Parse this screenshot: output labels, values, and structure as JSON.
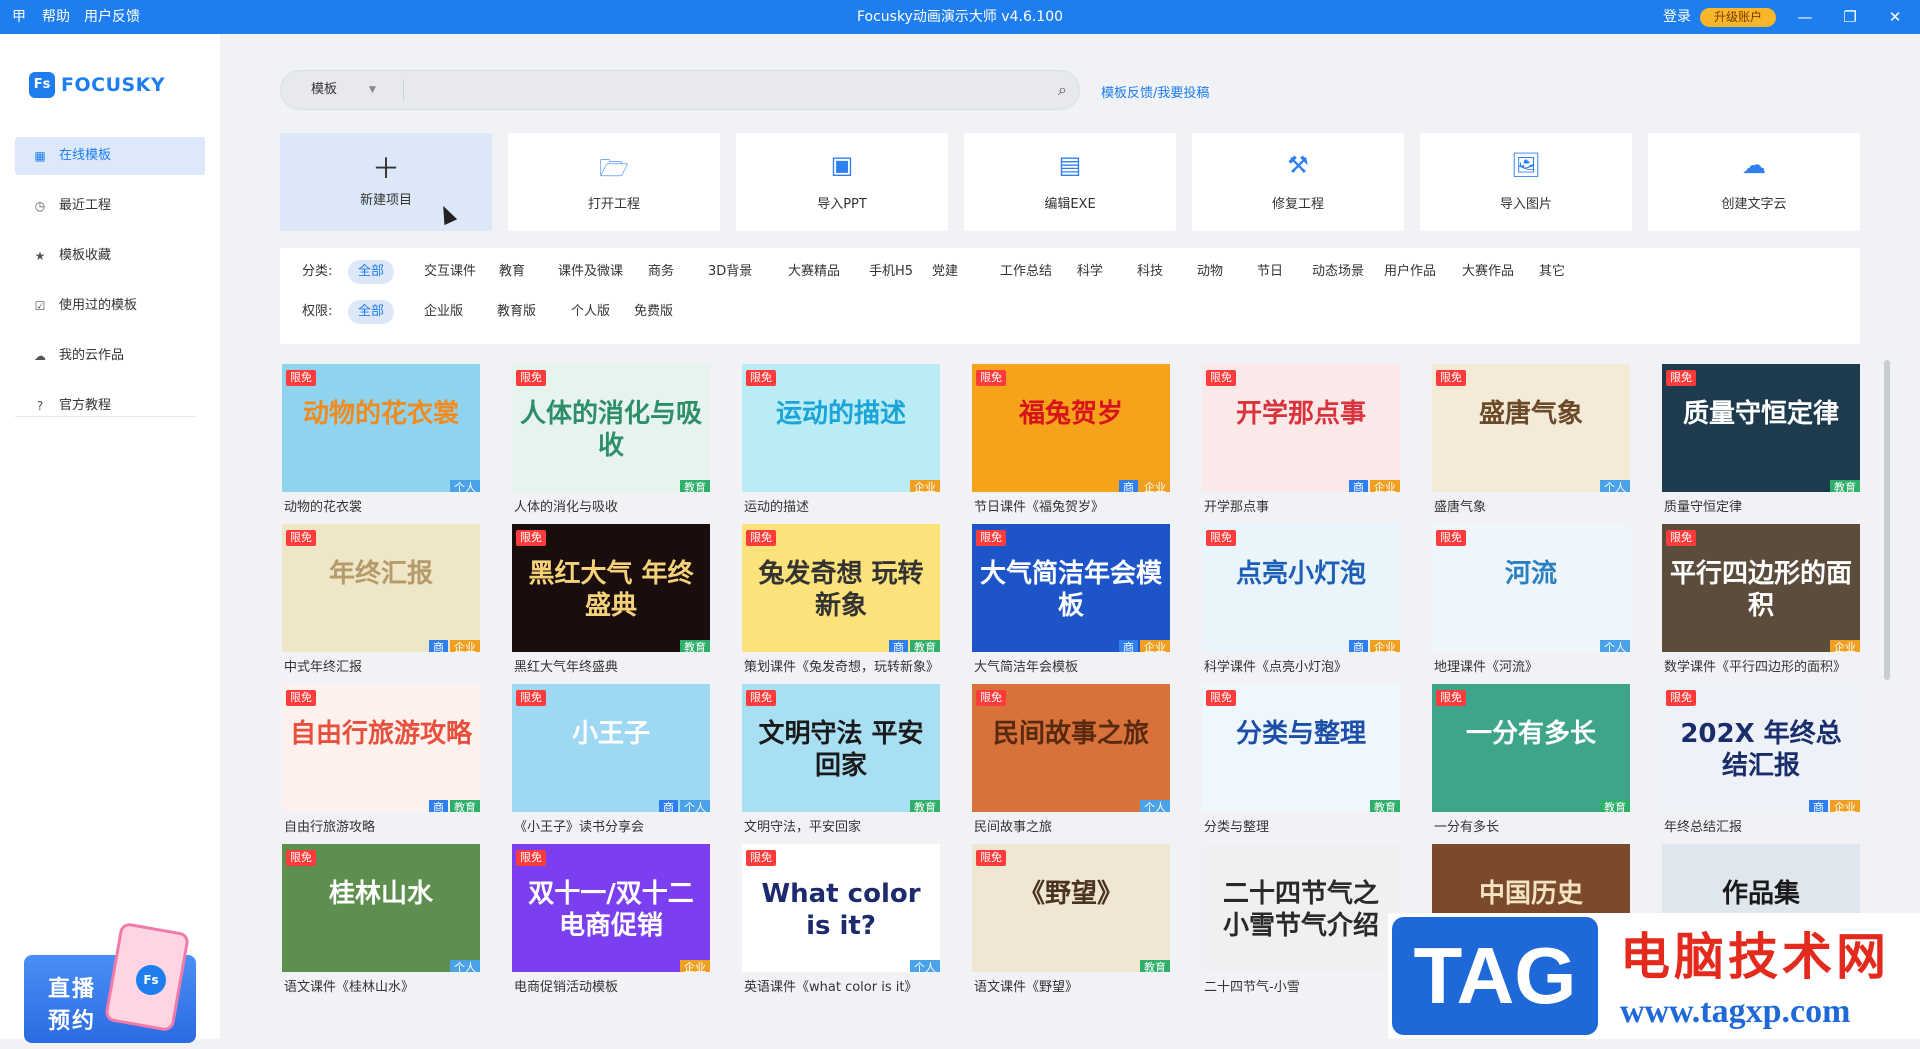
{
  "titlebar": {
    "pin": "甲",
    "help": "帮助",
    "feedback": "用户反馈",
    "title": "Focusky动画演示大师 v4.6.100",
    "login": "登录",
    "upgrade": "升级账户",
    "min": "—",
    "max": "❐",
    "close": "✕"
  },
  "logo": {
    "mark": "Fs",
    "name": "FOCUSKY"
  },
  "nav": [
    {
      "label": "在线模板",
      "icon": "grid-icon"
    },
    {
      "label": "最近工程",
      "icon": "clock-icon"
    },
    {
      "label": "模板收藏",
      "icon": "star-icon"
    },
    {
      "label": "使用过的模板",
      "icon": "check-icon"
    },
    {
      "label": "我的云作品",
      "icon": "cloud-icon"
    },
    {
      "label": "官方教程",
      "icon": "help-icon"
    }
  ],
  "promo": {
    "line1": "直播",
    "line2": "预约",
    "badge": "Fs"
  },
  "search": {
    "category": "模板",
    "value": ""
  },
  "feedback_link": "模板反馈/我要投稿",
  "actions": [
    {
      "label": "新建项目",
      "glyph": "＋"
    },
    {
      "label": "打开工程",
      "glyph": "🗁"
    },
    {
      "label": "导入PPT",
      "glyph": "▣"
    },
    {
      "label": "编辑EXE",
      "glyph": "▤"
    },
    {
      "label": "修复工程",
      "glyph": "⚒"
    },
    {
      "label": "导入图片",
      "glyph": "🖼"
    },
    {
      "label": "创建文字云",
      "glyph": "☁"
    }
  ],
  "filters": {
    "cat_label": "分类:",
    "categories": [
      "全部",
      "交互课件",
      "教育",
      "课件及微课",
      "商务",
      "3D背景",
      "大赛精品",
      "手机H5",
      "党建",
      "工作总结",
      "科学",
      "科技",
      "动物",
      "节日",
      "动态场景",
      "用户作品",
      "大赛作品",
      "其它"
    ],
    "perm_label": "权限:",
    "permissions": [
      "全部",
      "企业版",
      "教育版",
      "个人版",
      "免费版"
    ]
  },
  "templates": [
    {
      "name": "动物的花衣裳",
      "thumb": "动物的花衣裳",
      "xm": "限免",
      "tags": [
        "个人"
      ],
      "bg": "#8fd3ef",
      "fg": "#f28a1c"
    },
    {
      "name": "人体的消化与吸收",
      "thumb": "人体的消化与吸收",
      "xm": "限免",
      "tags": [
        "教育"
      ],
      "bg": "#e7f3ee",
      "fg": "#2d8f6a"
    },
    {
      "name": "运动的描述",
      "thumb": "运动的描述",
      "xm": "限免",
      "tags": [
        "企业"
      ],
      "bg": "#b9ecf5",
      "fg": "#1aa4d8"
    },
    {
      "name": "节日课件《福兔贺岁》",
      "thumb": "福兔贺岁",
      "xm": "限免",
      "tags": [
        "商",
        "企业"
      ],
      "bg": "#f7a21b",
      "fg": "#d6141b"
    },
    {
      "name": "开学那点事",
      "thumb": "开学那点事",
      "xm": "限免",
      "tags": [
        "商",
        "企业"
      ],
      "bg": "#fbe9ea",
      "fg": "#d9343e"
    },
    {
      "name": "盛唐气象",
      "thumb": "盛唐气象",
      "xm": "限免",
      "tags": [
        "个人"
      ],
      "bg": "#f3ead7",
      "fg": "#6b4a2a"
    },
    {
      "name": "质量守恒定律",
      "thumb": "质量守恒定律",
      "xm": "限免",
      "tags": [
        "教育"
      ],
      "bg": "#1d3b4d",
      "fg": "#ffffff"
    },
    {
      "name": "中式年终汇报",
      "thumb": "年终汇报",
      "xm": "限免",
      "tags": [
        "商",
        "企业"
      ],
      "bg": "#efe6c8",
      "fg": "#b59a6a"
    },
    {
      "name": "黑红大气年终盛典",
      "thumb": "黑红大气 年终盛典",
      "xm": "限免",
      "tags": [
        "教育"
      ],
      "bg": "#1a0d0d",
      "fg": "#f5d27a"
    },
    {
      "name": "策划课件《兔发奇想，玩转新象》",
      "thumb": "兔发奇想 玩转新象",
      "xm": "限免",
      "tags": [
        "商",
        "教育"
      ],
      "bg": "#fbe27a",
      "fg": "#333333"
    },
    {
      "name": "大气简洁年会模板",
      "thumb": "大气简洁年会模板",
      "xm": "限免",
      "tags": [
        "商",
        "企业"
      ],
      "bg": "#1d55c8",
      "fg": "#ffffff"
    },
    {
      "name": "科学课件《点亮小灯泡》",
      "thumb": "点亮小灯泡",
      "xm": "限免",
      "tags": [
        "商",
        "企业"
      ],
      "bg": "#e9f4fb",
      "fg": "#1d5fb6"
    },
    {
      "name": "地理课件《河流》",
      "thumb": "河流",
      "xm": "限免",
      "tags": [
        "个人"
      ],
      "bg": "#eef6fb",
      "fg": "#2a7fc0"
    },
    {
      "name": "数学课件《平行四边形的面积》",
      "thumb": "平行四边形的面积",
      "xm": "限免",
      "tags": [
        "企业"
      ],
      "bg": "#5c4c3c",
      "fg": "#ffffff"
    },
    {
      "name": "自由行旅游攻略",
      "thumb": "自由行旅游攻略",
      "xm": "限免",
      "tags": [
        "商",
        "教育"
      ],
      "bg": "#fdf1ee",
      "fg": "#e8503e"
    },
    {
      "name": "《小王子》读书分享会",
      "thumb": "小王子",
      "xm": "限免",
      "tags": [
        "商",
        "个人"
      ],
      "bg": "#9fd8f2",
      "fg": "#ffffff"
    },
    {
      "name": "文明守法，平安回家",
      "thumb": "文明守法 平安回家",
      "xm": "限免",
      "tags": [
        "教育"
      ],
      "bg": "#a8dff3",
      "fg": "#1a1a1a"
    },
    {
      "name": "民间故事之旅",
      "thumb": "民间故事之旅",
      "xm": "限免",
      "tags": [
        "个人"
      ],
      "bg": "#d9723a",
      "fg": "#5a2a10"
    },
    {
      "name": "分类与整理",
      "thumb": "分类与整理",
      "xm": "限免",
      "tags": [
        "教育"
      ],
      "bg": "#eef7fc",
      "fg": "#1e4fa8"
    },
    {
      "name": "一分有多长",
      "thumb": "一分有多长",
      "xm": "限免",
      "tags": [
        "教育"
      ],
      "bg": "#3fa58a",
      "fg": "#ffffff"
    },
    {
      "name": "年终总结汇报",
      "thumb": "202X 年终总结汇报",
      "xm": "限免",
      "tags": [
        "商",
        "企业"
      ],
      "bg": "#eef1f8",
      "fg": "#1a2d6b"
    },
    {
      "name": "语文课件《桂林山水》",
      "thumb": "桂林山水",
      "xm": "限免",
      "tags": [
        "个人"
      ],
      "bg": "#5f8f4e",
      "fg": "#ffffff"
    },
    {
      "name": "电商促销活动模板",
      "thumb": "双十一/双十二 电商促销",
      "xm": "限免",
      "tags": [
        "企业"
      ],
      "bg": "#7b3ff0",
      "fg": "#ffffff"
    },
    {
      "name": "英语课件《what color is it》",
      "thumb": "What color is it?",
      "xm": "限免",
      "tags": [
        "个人"
      ],
      "bg": "#ffffff",
      "fg": "#1d2a6b"
    },
    {
      "name": "语文课件《野望》",
      "thumb": "《野望》",
      "xm": "限免",
      "tags": [
        "教育"
      ],
      "bg": "#efe6d4",
      "fg": "#4a3320"
    },
    {
      "name": "二十四节气-小雪",
      "thumb": "二十四节气之 小雪节气介绍",
      "xm": "",
      "tags": [],
      "bg": "#eef0f2",
      "fg": "#2a2a2a"
    },
    {
      "name": "",
      "thumb": "中国历史",
      "xm": "",
      "tags": [],
      "bg": "#7a4a2a",
      "fg": "#f3e3c3"
    },
    {
      "name": "",
      "thumb": "作品集",
      "xm": "",
      "tags": [],
      "bg": "#dfe6ee",
      "fg": "#1a1a1a"
    }
  ],
  "watermark": {
    "tag": "TAG",
    "site": "电脑技术网",
    "url": "www.tagxp.com"
  },
  "colors": {
    "brand": "#1e7ef0",
    "limited": "#ff3b3b",
    "tag_shang": "#2f7ff0",
    "tag_qiye": "#f0a020",
    "tag_jiaoyu": "#2fb06a",
    "tag_geren": "#4aa3e8"
  }
}
